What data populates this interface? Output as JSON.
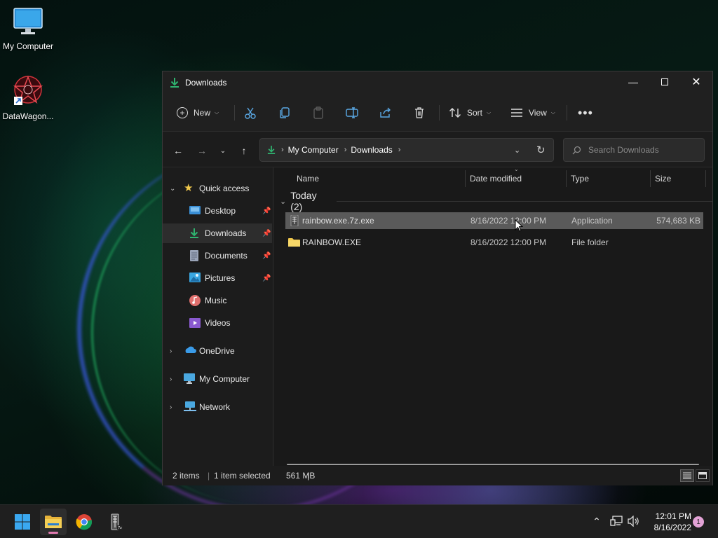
{
  "desktop": {
    "icons": [
      {
        "label": "My Computer",
        "icon": "monitor-icon"
      },
      {
        "label": "DataWagon...",
        "icon": "datawagon-shortcut-icon"
      }
    ]
  },
  "window": {
    "title": "Downloads",
    "title_icon": "download-icon",
    "controls": {
      "minimize": "minimize-icon",
      "maximize": "maximize-icon",
      "close": "close-icon"
    }
  },
  "toolbar": {
    "new_label": "New",
    "sort_label": "Sort",
    "view_label": "View",
    "icons": [
      "new-icon",
      "cut-icon",
      "copy-icon",
      "paste-icon",
      "rename-icon",
      "share-icon",
      "delete-icon",
      "sort-icon",
      "view-icon",
      "more-icon"
    ]
  },
  "navigation": {
    "breadcrumbs": [
      "My Computer",
      "Downloads"
    ],
    "search_placeholder": "Search Downloads"
  },
  "sidebar": {
    "quick_access": "Quick access",
    "items": [
      {
        "label": "Desktop",
        "icon": "desktop-folder-icon",
        "pinned": true,
        "color": "#3a8fd6"
      },
      {
        "label": "Downloads",
        "icon": "download-icon",
        "pinned": true,
        "color": "#2fb36f",
        "selected": true
      },
      {
        "label": "Documents",
        "icon": "documents-icon",
        "pinned": true,
        "color": "#9aa4b8"
      },
      {
        "label": "Pictures",
        "icon": "pictures-icon",
        "pinned": true,
        "color": "#3aa6e0"
      },
      {
        "label": "Music",
        "icon": "music-icon",
        "pinned": false,
        "color": "#e0706e"
      },
      {
        "label": "Videos",
        "icon": "videos-icon",
        "pinned": false,
        "color": "#8a5ad0"
      }
    ],
    "roots": [
      {
        "label": "OneDrive",
        "icon": "onedrive-icon",
        "color": "#3a9be8"
      },
      {
        "label": "My Computer",
        "icon": "computer-icon",
        "color": "#4aa8e0"
      },
      {
        "label": "Network",
        "icon": "network-icon",
        "color": "#4aa8e0"
      }
    ]
  },
  "columns": {
    "name": "Name",
    "date": "Date modified",
    "type": "Type",
    "size": "Size"
  },
  "group": {
    "label": "Today (2)"
  },
  "files": [
    {
      "name": "rainbow.exe.7z.exe",
      "date": "8/16/2022 12:00 PM",
      "type": "Application",
      "size": "574,683 KB",
      "icon": "7z-installer-icon",
      "selected": true
    },
    {
      "name": "RAINBOW.EXE",
      "date": "8/16/2022 12:00 PM",
      "type": "File folder",
      "size": "",
      "icon": "folder-icon",
      "selected": false
    }
  ],
  "status": {
    "count": "2 items",
    "selection": "1 item selected",
    "size": "561 MB",
    "separator": "|"
  },
  "taskbar": {
    "apps": [
      "start-icon",
      "file-explorer-icon",
      "chrome-icon",
      "7zip-icon"
    ],
    "tray": [
      "chevron-up-icon",
      "network-icon",
      "volume-icon"
    ],
    "time": "12:01 PM",
    "date": "8/16/2022",
    "notifications": "1"
  },
  "colors": {
    "accent_green": "#2fb36f",
    "selected_row": "#5a5a5a",
    "folder_yellow": "#f2c94c"
  }
}
